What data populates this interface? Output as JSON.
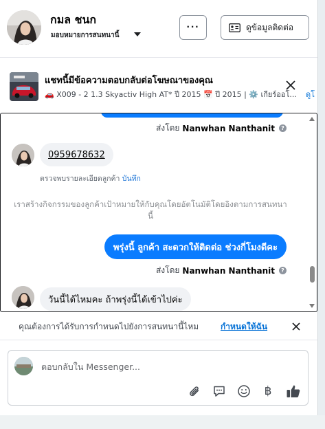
{
  "header": {
    "name": "กมล ชนก",
    "assign_label": "มอบหมายการสนทนานี้",
    "more_label": "···",
    "contact_label": "ดูข้อมูลติดต่อ"
  },
  "ad": {
    "title": "แชทนี้มีข้อความตอบกลับต่อโฆษณาของคุณ",
    "detail": "🚗 X009 - 2 1.3 Skyactiv High AT* ปี 2015 📅 ปี 2015 | ⚙️ เกียร์ออโ...",
    "link": "ดูโ"
  },
  "chat": {
    "messages": [
      {
        "sent_by_prefix": "ส่งโดย",
        "sent_by_name": "Nanwhan Nanthanit"
      },
      {
        "text": "0959678632",
        "note_text": "ตรวจพบรายละเอียดลูกค้า",
        "note_link": "บันทึก"
      },
      {
        "system": "เราสร้างกิจกรรมของลูกค้าเป้าหมายให้กับคุณโดยอัตโนมัติโดยอิงตามการสนทนานี้"
      },
      {
        "text": "พรุ่งนี้ ลูกค้า  สะดวกให้ติดต่อ ช่วงกี่โมงดีคะ",
        "sent_by_prefix": "ส่งโดย",
        "sent_by_name": "Nanwhan Nanthanit"
      },
      {
        "text": "วันนี้ได้ไหมคะ ถ้าพรุ่งนี้ได้เข้าไปค่ะ"
      }
    ]
  },
  "followup": {
    "text": "คุณต้องการได้รับการกำหนดไปยังการสนทนานี้ไหม",
    "link": "กำหนดให้ฉัน"
  },
  "composer": {
    "placeholder": "ตอบกลับใน Messenger...",
    "currency_symbol": "฿"
  },
  "colors": {
    "accent": "#0a7cff",
    "link": "#0571d6"
  }
}
